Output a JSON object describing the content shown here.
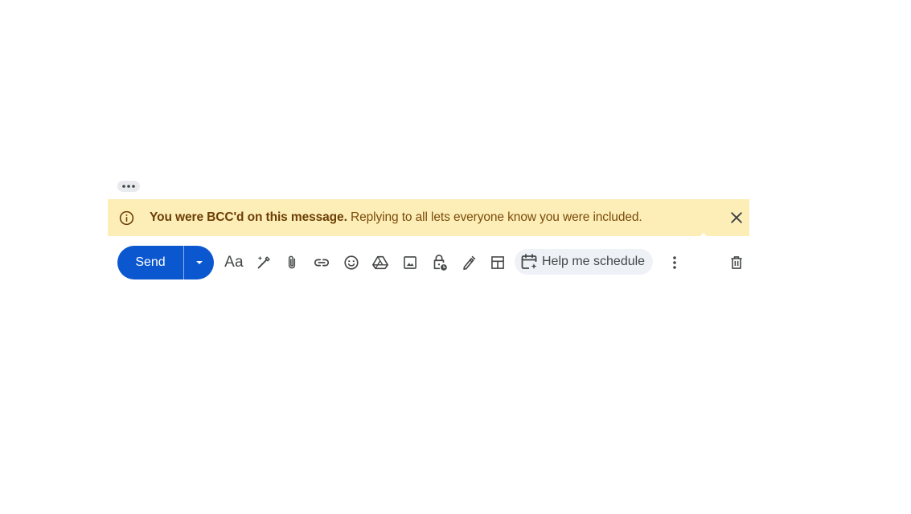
{
  "thread": {
    "show_trimmed_label": "Show trimmed content"
  },
  "banner": {
    "bold_text": "You were BCC'd on this message.",
    "body_text": " Replying to all lets everyone know you were included.",
    "icon": "info-icon",
    "close_icon": "close-icon",
    "background_color": "#fdeeb8",
    "text_color": "#7a4b0a"
  },
  "toolbar": {
    "send_label": "Send",
    "send_color": "#0b57d0",
    "send_options_icon": "arrow-drop-down-icon",
    "format_label": "Aa",
    "tools": [
      {
        "name": "format-options",
        "icon": "text-format-icon"
      },
      {
        "name": "help-me-write",
        "icon": "magic-pen-icon"
      },
      {
        "name": "attach-files",
        "icon": "paperclip-icon"
      },
      {
        "name": "insert-link",
        "icon": "link-icon"
      },
      {
        "name": "insert-emoji",
        "icon": "emoji-icon"
      },
      {
        "name": "insert-drive",
        "icon": "drive-icon"
      },
      {
        "name": "insert-photo",
        "icon": "photo-icon"
      },
      {
        "name": "confidential-mode",
        "icon": "lock-clock-icon"
      },
      {
        "name": "insert-signature",
        "icon": "pen-icon"
      },
      {
        "name": "layouts",
        "icon": "layout-icon"
      },
      {
        "name": "more-options",
        "icon": "more-vert-icon"
      },
      {
        "name": "discard-draft",
        "icon": "trash-icon"
      }
    ],
    "schedule_label": "Help me schedule",
    "schedule_icon": "calendar-sparkle-icon"
  }
}
